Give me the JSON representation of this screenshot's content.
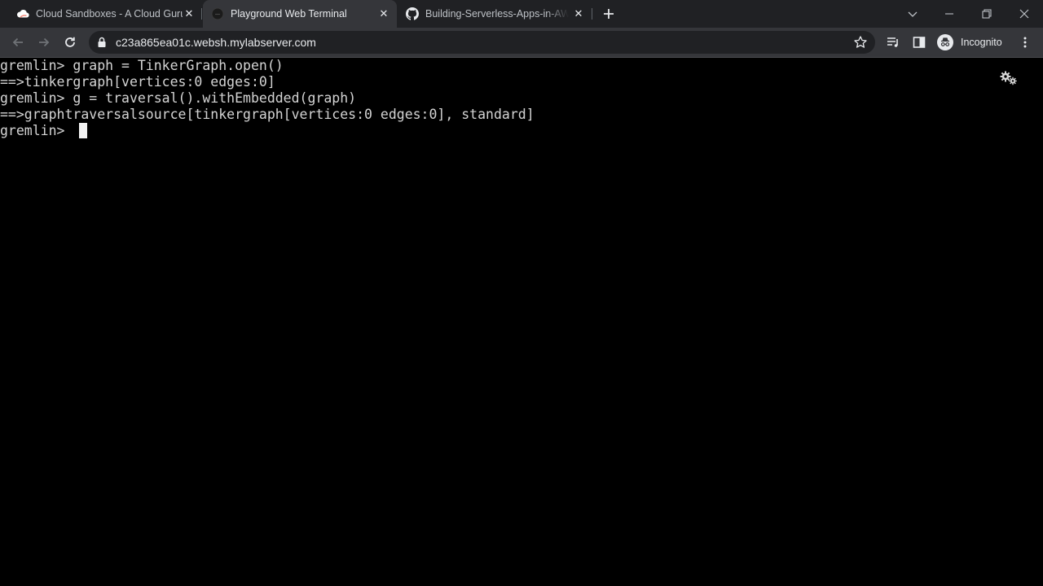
{
  "tabs": [
    {
      "title": "Cloud Sandboxes - A Cloud Guru",
      "favicon": "cloud-icon",
      "active": false
    },
    {
      "title": "Playground Web Terminal",
      "favicon": "terminal-icon",
      "active": true
    },
    {
      "title": "Building-Serverless-Apps-in-AWS",
      "favicon": "github-icon",
      "active": false
    }
  ],
  "toolbar": {
    "url": "c23a865ea01c.websh.mylabserver.com",
    "profile_label": "Incognito"
  },
  "terminal": {
    "lines": [
      "gremlin> graph = TinkerGraph.open()",
      "==>tinkergraph[vertices:0 edges:0]",
      "gremlin> g = traversal().withEmbedded(graph)",
      "==>graphtraversalsource[tinkergraph[vertices:0 edges:0], standard]",
      "gremlin> "
    ]
  },
  "colors": {
    "tabstrip_bg": "#202124",
    "active_tab_bg": "#35363a",
    "omnibox_bg": "#202124",
    "terminal_bg": "#000000",
    "terminal_fg": "#d4d4d4"
  }
}
